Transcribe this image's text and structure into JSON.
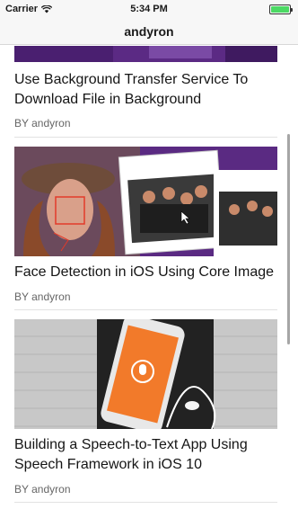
{
  "status_bar": {
    "carrier": "Carrier",
    "time": "5:34 PM"
  },
  "nav": {
    "title": "andyron"
  },
  "articles": [
    {
      "title": "Use Background Transfer Service To Download File in Background",
      "author": "BY andyron",
      "image": "purple-banner-image"
    },
    {
      "title": "Face Detection in iOS Using Core Image",
      "author": "BY andyron",
      "image": "face-detection-collage-image"
    },
    {
      "title": "Building a Speech-to-Text App Using Speech Framework in iOS 10",
      "author": "BY andyron",
      "image": "phone-speech-app-image"
    }
  ],
  "colors": {
    "accent_purple": "#5c2a86",
    "phone_orange": "#f27a2a",
    "battery_green": "#4cd964"
  }
}
